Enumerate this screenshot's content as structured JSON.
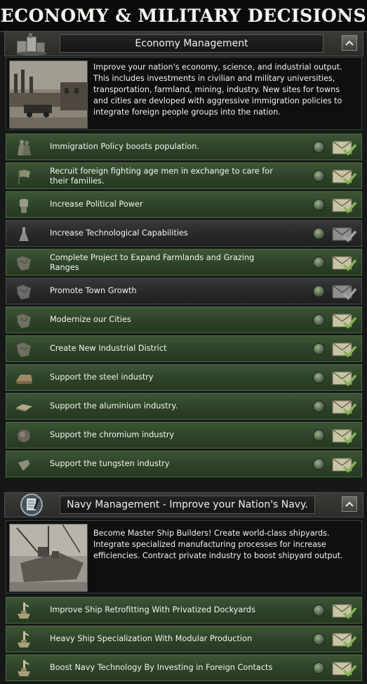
{
  "title": "ECONOMY & MILITARY DECISIONS",
  "economy": {
    "header": "Economy Management",
    "description": "Improve your nation's economy, science, and industrial output. This includes investments in civilian and military universities, transportation, farmland, mining, industry. New sites for towns and cities are devloped with aggressive immigration policies to integrate foreign people groups into the nation.",
    "items": [
      {
        "label": "Immigration Policy boosts population.",
        "icon": "soldiers-icon"
      },
      {
        "label": "Recruit foreign fighting age men in exchange to care for their families.",
        "icon": "flag-icon"
      },
      {
        "label": "Increase Political Power",
        "icon": "fist-icon"
      },
      {
        "label": "Increase Technological Capabilities",
        "icon": "flask-icon"
      },
      {
        "label": "Complete Project to Expand Farmlands and Grazing Ranges",
        "icon": "map-icon"
      },
      {
        "label": "Promote Town Growth",
        "icon": "map-icon"
      },
      {
        "label": "Modernize our Cities",
        "icon": "map-icon"
      },
      {
        "label": "Create New Industrial District",
        "icon": "map-icon"
      },
      {
        "label": "Support the steel industry",
        "icon": "steel-ingot-icon"
      },
      {
        "label": "Support the aluminium industry.",
        "icon": "aluminium-icon"
      },
      {
        "label": "Support the chromium industry",
        "icon": "chromium-icon"
      },
      {
        "label": "Support the tungsten industry",
        "icon": "tungsten-icon"
      }
    ]
  },
  "navy": {
    "header": "Navy Management - Improve your Nation's Navy.",
    "description": "Become Master Ship Builders! Create world-class shipyards. Integrate specialized manufacturing processes for increase efficiencies. Contract private industry to boost shipyard output.",
    "items": [
      {
        "label": "Improve Ship Retrofitting With Privatized Dockyards",
        "icon": "dockyard-icon"
      },
      {
        "label": "Heavy Ship Specialization With Modular Production",
        "icon": "dockyard-icon"
      },
      {
        "label": "Boost Navy Technology By Investing in Foreign Contacts",
        "icon": "dockyard-icon"
      }
    ]
  }
}
